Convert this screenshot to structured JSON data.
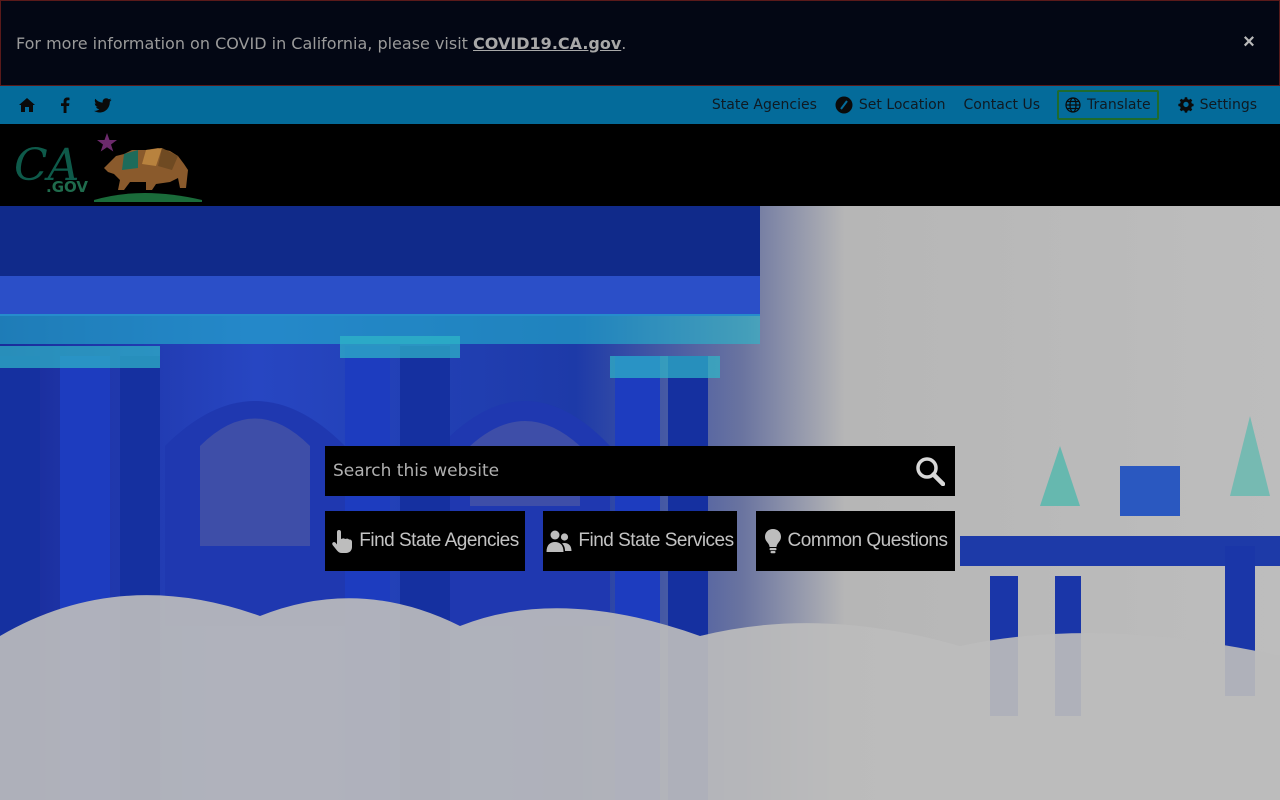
{
  "alert": {
    "text": "For more information on COVID in California, please visit ",
    "link_label": "COVID19.CA.gov",
    "suffix": ".",
    "close_label": "×"
  },
  "utility": {
    "social_icons": [
      "home-icon",
      "facebook-icon",
      "twitter-icon"
    ],
    "links": {
      "state_agencies": "State Agencies",
      "set_location": "Set Location",
      "contact_us": "Contact Us",
      "translate": "Translate",
      "settings": "Settings"
    }
  },
  "header": {
    "logo_text": "CA",
    "logo_sub": ".GOV"
  },
  "hero": {
    "search_placeholder": "Search this website",
    "buttons": {
      "find_agencies": "Find State Agencies",
      "find_services": "Find State Services",
      "common_questions": "Common Questions"
    }
  },
  "colors": {
    "utility_bar": "#046b9a",
    "alert_bg": "#030714",
    "header_bg": "#000000"
  }
}
